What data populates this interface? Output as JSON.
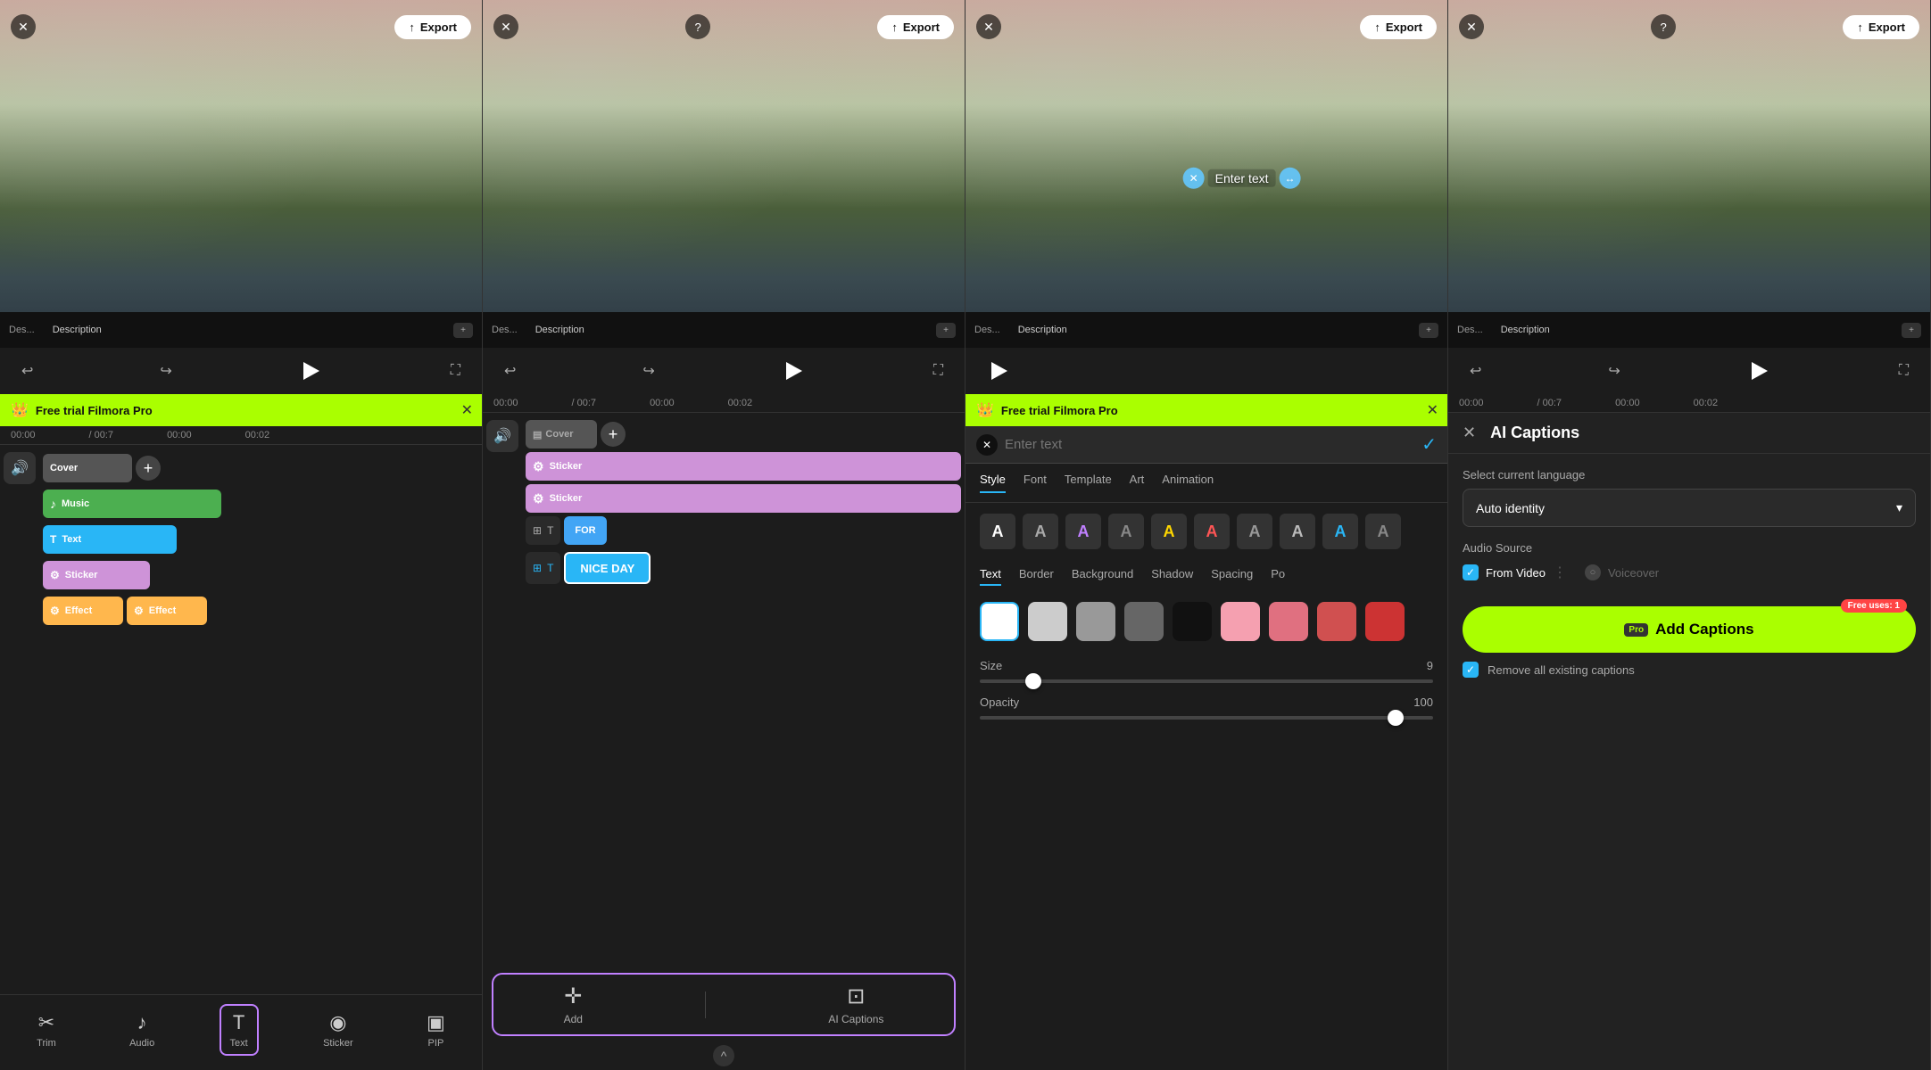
{
  "panels": [
    {
      "id": "panel1",
      "export_label": "Export",
      "free_trial_text": "Free trial Filmora Pro",
      "time_current": "00:00",
      "time_total": "/ 00:7",
      "timeline_markers": [
        "00:00",
        "00:02"
      ],
      "tracks": {
        "cover_label": "Cover",
        "music_label": "Music",
        "text_label": "Text",
        "sticker_label": "Sticker",
        "effect_label": "Effect"
      },
      "video_bottom_items": [
        "Des...",
        "Description"
      ]
    },
    {
      "id": "panel2",
      "export_label": "Export",
      "time_current": "00:00",
      "time_total": "/ 00:7",
      "timeline_markers": [
        "00:00",
        "00:02"
      ],
      "toolbar_items": [
        "Add",
        "AI Captions"
      ],
      "sticker_labels": [
        "Sticker",
        "Sticker"
      ],
      "for_label": "FOR",
      "niceday_label": "NICE DAY",
      "video_bottom_items": [
        "Des...",
        "Description"
      ]
    },
    {
      "id": "panel3",
      "free_trial_text": "Free trial Filmora Pro",
      "text_placeholder": "Enter text",
      "text_confirm": "✓",
      "tabs": [
        "Style",
        "Font",
        "Template",
        "Art",
        "Animation"
      ],
      "active_tab": "Style",
      "style_btns": [
        "A",
        "A",
        "A",
        "A",
        "A",
        "A",
        "A",
        "A",
        "A"
      ],
      "color_tabs": [
        "Text",
        "Border",
        "Background",
        "Shadow",
        "Spacing",
        "Po"
      ],
      "active_color_tab": "Text",
      "colors": [
        {
          "hex": "#ffffff",
          "selected": true
        },
        {
          "hex": "#cccccc",
          "selected": false
        },
        {
          "hex": "#999999",
          "selected": false
        },
        {
          "hex": "#666666",
          "selected": false
        },
        {
          "hex": "#111111",
          "selected": false
        },
        {
          "hex": "#f5a0b0",
          "selected": false
        },
        {
          "hex": "#e07080",
          "selected": false
        },
        {
          "hex": "#d05050",
          "selected": false
        },
        {
          "hex": "#cc3333",
          "selected": false
        }
      ],
      "size_label": "Size",
      "size_value": "9",
      "size_min": 0,
      "size_max": 100,
      "opacity_label": "Opacity",
      "opacity_value": "100",
      "text_overlay": "Enter text",
      "video_bottom_items": [
        "Des...",
        "Description"
      ]
    },
    {
      "id": "panel4",
      "export_label": "Export",
      "ai_captions_title": "AI Captions",
      "language_label": "Select current language",
      "language_value": "Auto identity",
      "audio_source_label": "Audio Source",
      "from_video_label": "From Video",
      "voiceover_label": "Voiceover",
      "add_captions_label": "Add Captions",
      "pro_badge": "Pro",
      "free_uses_badge": "Free uses: 1",
      "remove_label": "Remove all existing captions",
      "time_current": "00:00",
      "time_total": "/ 00:7",
      "video_bottom_items": [
        "Des...",
        "Description"
      ]
    }
  ]
}
